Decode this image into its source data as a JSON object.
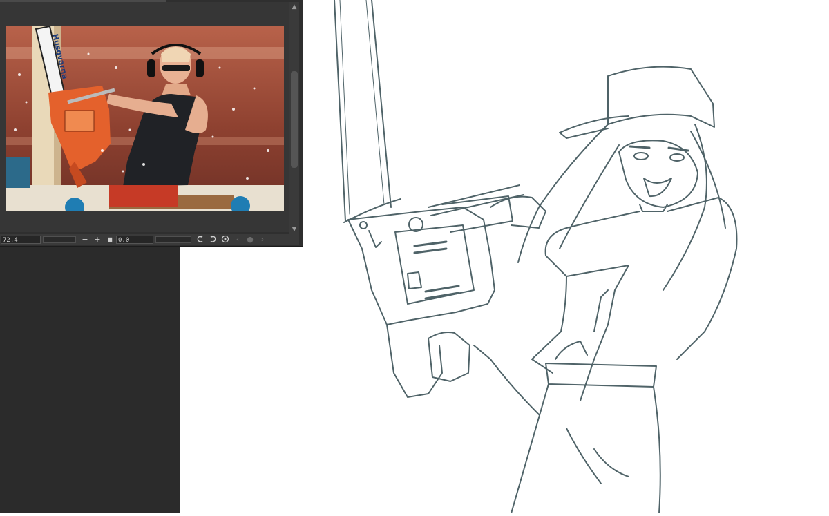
{
  "reference_window": {
    "photo_brand_text": "Husqvarna",
    "toolbar": {
      "zoom_value": "72.4",
      "zoom_out_label": "−",
      "zoom_in_label": "+",
      "stop_label": "■",
      "rotation_value": "0.0",
      "rotate_left_icon": "rotate-left-icon",
      "rotate_right_icon": "rotate-right-icon",
      "reset_icon": "reset-icon",
      "prev_icon": "prev-icon",
      "dot_icon": "dot-icon",
      "next_icon": "next-icon"
    },
    "scroll_up_label": "▲",
    "scroll_down_label": "▼"
  },
  "colors": {
    "dark_panel": "#2b2b2b",
    "line_art": "#4f6368",
    "canvas": "#ffffff"
  }
}
